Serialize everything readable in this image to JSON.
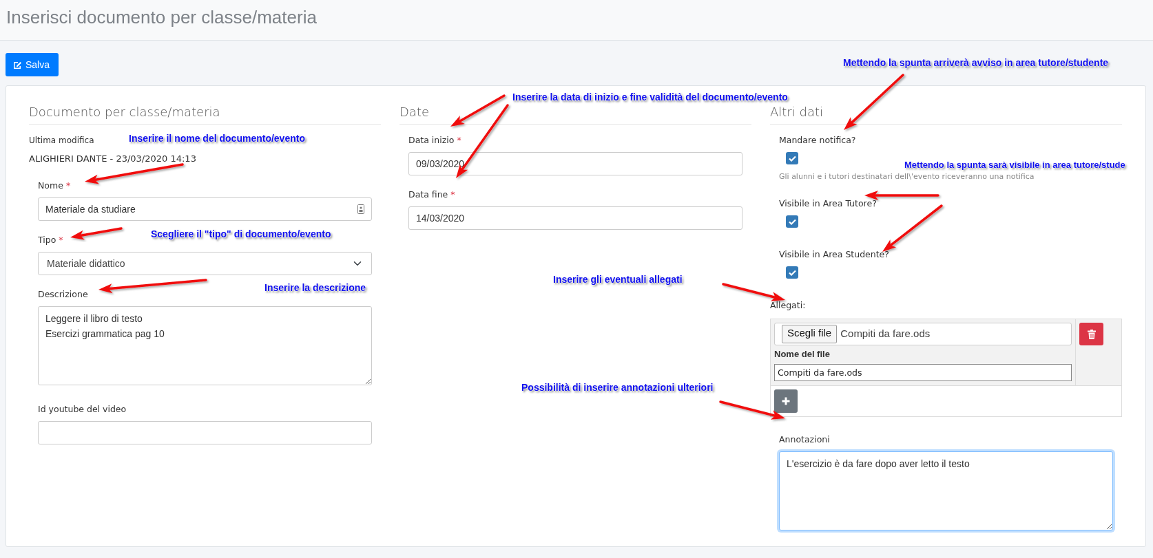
{
  "page_title": "Inserisci documento per classe/materia",
  "toolbar": {
    "save_button": "Salva"
  },
  "sections": [
    {
      "title": "Documento per classe/materia",
      "meta_label": "Ultima modifica",
      "meta_value": "ALIGHIERI DANTE - 23/03/2020 14:13",
      "fields": [
        {
          "kind": "text",
          "label": "Nome",
          "required_mark": "*",
          "value": "Materiale da studiare",
          "autofill": true
        },
        {
          "kind": "select",
          "label": "Tipo",
          "required_mark": "*",
          "value": "Materiale didattico"
        },
        {
          "kind": "textarea",
          "label": "Descrizione",
          "value": "Leggere il libro di testo\nEsercizi grammatica pag 10",
          "focused": false
        },
        {
          "kind": "text",
          "label": "Id youtube del video",
          "autofill": false
        }
      ]
    },
    {
      "title": "Date",
      "fields": [
        {
          "kind": "text",
          "label": "Data inizio",
          "required_mark": "*",
          "value": "09/03/2020",
          "autofill": false
        },
        {
          "kind": "text",
          "label": "Data fine",
          "required_mark": "*",
          "value": "14/03/2020",
          "autofill": false
        }
      ]
    },
    {
      "title": "Altri dati",
      "fields": [
        {
          "kind": "checkbox",
          "label": "Mandare notifica?",
          "checked": true,
          "help": "Gli alunni e i tutori destinatari dell\\'evento riceveranno una notifica"
        },
        {
          "kind": "checkbox",
          "label": "Visibile in Area Tutore?",
          "checked": true
        },
        {
          "kind": "checkbox",
          "label": "Visibile in Area Studente?",
          "checked": true
        },
        {
          "kind": "attachments",
          "label": "Allegati:",
          "files": [
            {
              "choose_button": "Scegli file",
              "chosen_file": "Compiti da fare.ods",
              "name_label": "Nome del file",
              "name_value": "Compiti da fare.ods"
            }
          ]
        },
        {
          "kind": "textarea",
          "label": "Annotazioni",
          "value": "L'esercizio è da fare dopo aver letto il testo",
          "focused": true
        }
      ]
    }
  ],
  "callouts": [
    {
      "text": "Inserire il nome del documento/evento"
    },
    {
      "text": "Scegliere il \"tipo\" di documento/evento"
    },
    {
      "text": "Inserire la descrizione"
    },
    {
      "text": "Inserire la data di inizio e fine validità del documento/evento"
    },
    {
      "text": "Mettendo la spunta arriverà avviso in area tutore/studente"
    },
    {
      "text": "Mettendo la spunta sarà visibile in area tutore/stude"
    },
    {
      "text": "Inserire gli eventuali allegati"
    },
    {
      "text": "Possibilità di inserire annotazioni ulteriori"
    }
  ]
}
